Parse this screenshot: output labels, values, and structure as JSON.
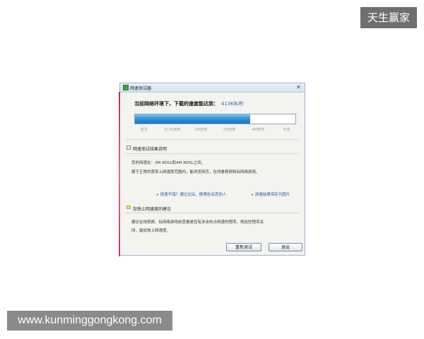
{
  "watermarks": {
    "top_right": "天生赢家",
    "bottom_left": "www.kunminggongkong.com"
  },
  "window": {
    "title": "网速测试器",
    "icons": {
      "app": "app-icon",
      "close": "close-icon"
    }
  },
  "result": {
    "headline": "当前网络环境下，下载的速度能达到：",
    "speed": "413KB/秒"
  },
  "progress": {
    "value": 0.72,
    "ticks": [
      "拨号",
      "512K宽带",
      "1M宽带",
      "2M宽带",
      "4M宽带",
      "专线"
    ]
  },
  "sections": {
    "result_title": "网速测试结果说明",
    "result_line1": "您的网速在：3M ADSL和4M ADSL之间。",
    "result_line2": "属于正常的宽带上网速度范围内，能浏览网页，在线看视频和玩网络游戏。",
    "speedup_title": "加快上网速度的建议",
    "speedup_line1": "建议在线视频、玩网络游戏前查看是否有多余的占网速的程序，将这些程序关",
    "speedup_line2": "闭，能加快上网速度。"
  },
  "links": {
    "share": "网速不错？通过论坛、微博告诉其他人",
    "save": "测速结果保存为图片"
  },
  "buttons": {
    "retest": "重新测试",
    "exit": "退出"
  }
}
